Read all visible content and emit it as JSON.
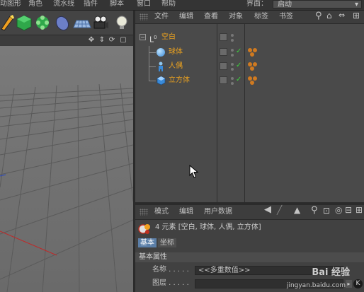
{
  "menubar": {
    "items": [
      "动图形",
      "角色",
      "流水线",
      "插件",
      "脚本",
      "窗口",
      "帮助"
    ],
    "layout_label": "界面：",
    "layout_value": "启动"
  },
  "object_manager": {
    "menu": [
      "文件",
      "编辑",
      "查看",
      "对象",
      "标签",
      "书签"
    ],
    "objects": [
      {
        "name": "空白",
        "type": "null",
        "color": "#e8a020"
      },
      {
        "name": "球体",
        "type": "sphere",
        "color": "#e8a020"
      },
      {
        "name": "人偶",
        "type": "figure",
        "color": "#e8a020"
      },
      {
        "name": "立方体",
        "type": "cube",
        "color": "#e8a020"
      }
    ]
  },
  "attributes": {
    "menu": [
      "模式",
      "编辑",
      "用户数据"
    ],
    "description": "4 元素 [空白, 球体, 人偶, 立方体]",
    "tabs": [
      "基本",
      "坐标"
    ],
    "section_title": "基本属性",
    "fields": [
      {
        "label": "名称 . . . . .",
        "value": "<<多重数值>>"
      },
      {
        "label": "图层 . . . . .",
        "value": ""
      }
    ]
  },
  "watermark": {
    "text": "Bai 经验",
    "url": "jingyan.baidu.com"
  },
  "colors": {
    "accent": "#5b7fa8",
    "object_label": "#e8a020",
    "check": "#3cd03c"
  }
}
